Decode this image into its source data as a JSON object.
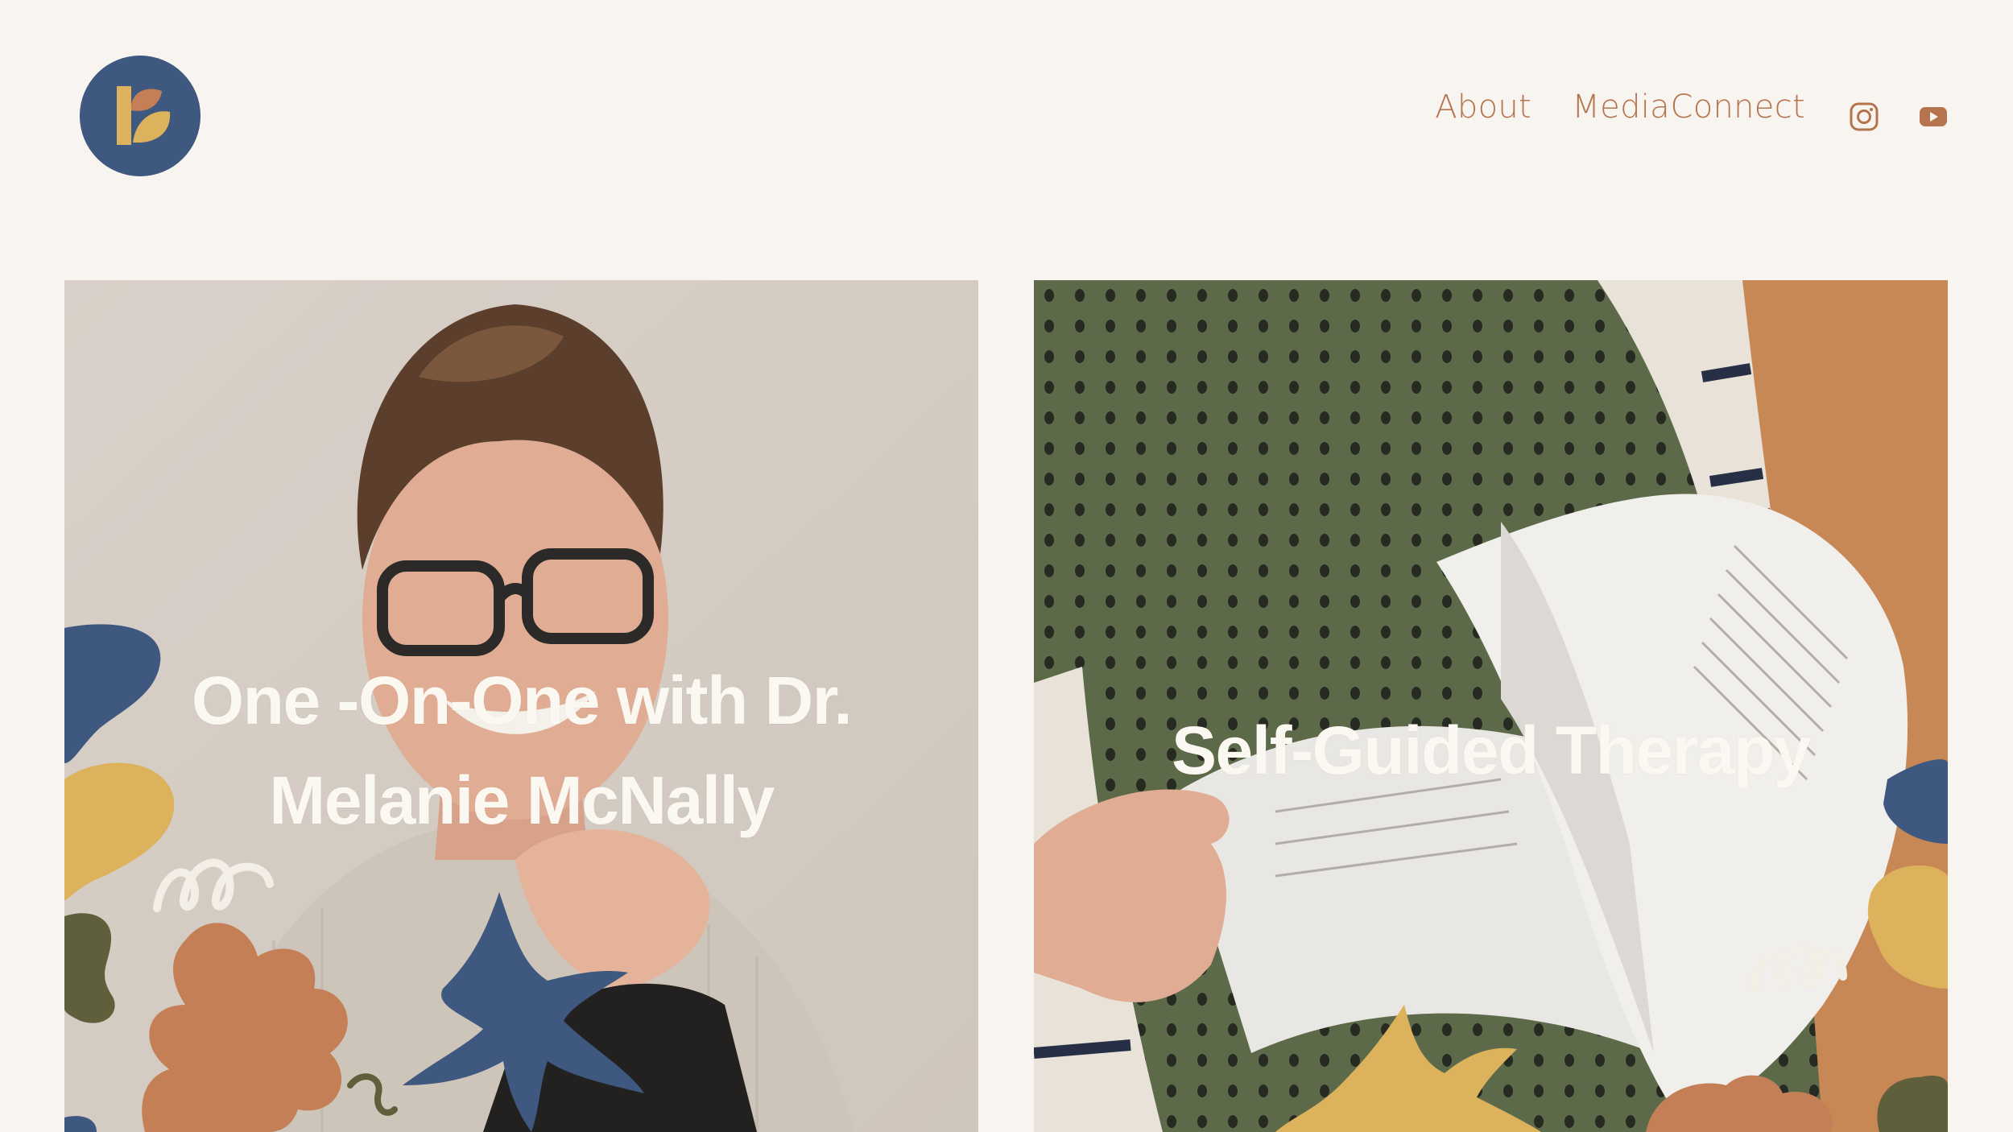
{
  "site": {
    "logo_name": "brand-logo",
    "colors": {
      "background": "#f8f5f1",
      "accent": "#b5744d",
      "navy": "#3f587f",
      "mustard": "#dcb25c",
      "terracotta": "#c47f57",
      "olive": "#5f5f3c",
      "cream_text": "#fbf7f1"
    }
  },
  "nav": {
    "items": [
      {
        "label": "About"
      },
      {
        "label": "Media"
      },
      {
        "label": "Connect"
      }
    ],
    "social": [
      {
        "icon": "instagram-icon"
      },
      {
        "icon": "youtube-icon"
      }
    ]
  },
  "cards": [
    {
      "title_line1": "One -On-One with Dr.",
      "title_line2": "Melanie McNally",
      "image": "portrait-photo"
    },
    {
      "title": "Self-Guided Therapy",
      "image": "book-photo"
    }
  ]
}
